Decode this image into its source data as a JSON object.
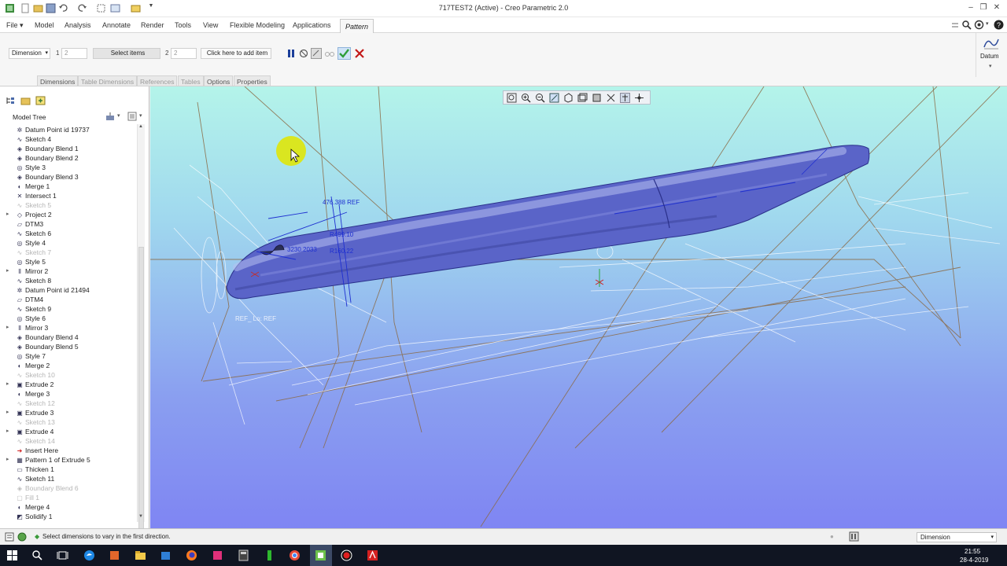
{
  "app": {
    "window_title": "717TEST2 (Active) - Creo Parametric 2.0"
  },
  "menu": {
    "file_label": "File",
    "items": [
      "Model",
      "Analysis",
      "Annotate",
      "Render",
      "Tools",
      "View",
      "Flexible Modeling",
      "Applications"
    ],
    "active_tab": "Pattern"
  },
  "ribbon": {
    "type_value": "Dimension",
    "dir1_index": "1",
    "dir1_count": "2",
    "dir1_select": "Select items",
    "dir2_index": "2",
    "dir2_count": "2",
    "dir2_add": "Click here to add item",
    "datum_label": "Datum",
    "subtabs": [
      "Dimensions",
      "Table Dimensions",
      "References",
      "Tables",
      "Options",
      "Properties"
    ]
  },
  "model_tree": {
    "header": "Model Tree",
    "items": [
      {
        "label": "Datum Point id 19737",
        "icon": "datum-point-icon",
        "icon_glyph": "✲",
        "state": "normal",
        "expandable": false
      },
      {
        "label": "Sketch 4",
        "icon": "sketch-icon",
        "icon_glyph": "∿",
        "state": "normal",
        "expandable": false
      },
      {
        "label": "Boundary Blend 1",
        "icon": "boundary-blend-icon",
        "icon_glyph": "◈",
        "state": "normal",
        "expandable": false
      },
      {
        "label": "Boundary Blend 2",
        "icon": "boundary-blend-icon",
        "icon_glyph": "◈",
        "state": "normal",
        "expandable": false
      },
      {
        "label": "Style 3",
        "icon": "style-icon",
        "icon_glyph": "◎",
        "state": "normal",
        "expandable": false
      },
      {
        "label": "Boundary Blend 3",
        "icon": "boundary-blend-icon",
        "icon_glyph": "◈",
        "state": "normal",
        "expandable": false
      },
      {
        "label": "Merge 1",
        "icon": "merge-icon",
        "icon_glyph": "◐",
        "state": "normal",
        "expandable": false
      },
      {
        "label": "Intersect 1",
        "icon": "intersect-icon",
        "icon_glyph": "✕",
        "state": "normal",
        "expandable": false
      },
      {
        "label": "Sketch 5",
        "icon": "sketch-icon",
        "icon_glyph": "∿",
        "state": "grey",
        "expandable": false
      },
      {
        "label": "Project 2",
        "icon": "project-icon",
        "icon_glyph": "◇",
        "state": "normal",
        "expandable": true
      },
      {
        "label": "DTM3",
        "icon": "datum-plane-icon",
        "icon_glyph": "▱",
        "state": "normal",
        "expandable": false
      },
      {
        "label": "Sketch 6",
        "icon": "sketch-icon",
        "icon_glyph": "∿",
        "state": "normal",
        "expandable": false
      },
      {
        "label": "Style 4",
        "icon": "style-icon",
        "icon_glyph": "◎",
        "state": "normal",
        "expandable": false
      },
      {
        "label": "Sketch 7",
        "icon": "sketch-icon",
        "icon_glyph": "∿",
        "state": "grey",
        "expandable": false
      },
      {
        "label": "Style 5",
        "icon": "style-icon",
        "icon_glyph": "◎",
        "state": "normal",
        "expandable": false
      },
      {
        "label": "Mirror 2",
        "icon": "mirror-icon",
        "icon_glyph": "⫴",
        "state": "normal",
        "expandable": true
      },
      {
        "label": "Sketch 8",
        "icon": "sketch-icon",
        "icon_glyph": "∿",
        "state": "normal",
        "expandable": false
      },
      {
        "label": "Datum Point id 21494",
        "icon": "datum-point-icon",
        "icon_glyph": "✲",
        "state": "normal",
        "expandable": false
      },
      {
        "label": "DTM4",
        "icon": "datum-plane-icon",
        "icon_glyph": "▱",
        "state": "normal",
        "expandable": false
      },
      {
        "label": "Sketch 9",
        "icon": "sketch-icon",
        "icon_glyph": "∿",
        "state": "normal",
        "expandable": false
      },
      {
        "label": "Style 6",
        "icon": "style-icon",
        "icon_glyph": "◎",
        "state": "normal",
        "expandable": false
      },
      {
        "label": "Mirror 3",
        "icon": "mirror-icon",
        "icon_glyph": "⫴",
        "state": "normal",
        "expandable": true
      },
      {
        "label": "Boundary Blend 4",
        "icon": "boundary-blend-icon",
        "icon_glyph": "◈",
        "state": "normal",
        "expandable": false
      },
      {
        "label": "Boundary Blend 5",
        "icon": "boundary-blend-icon",
        "icon_glyph": "◈",
        "state": "normal",
        "expandable": false
      },
      {
        "label": "Style 7",
        "icon": "style-icon",
        "icon_glyph": "◎",
        "state": "normal",
        "expandable": false
      },
      {
        "label": "Merge 2",
        "icon": "merge-icon",
        "icon_glyph": "◐",
        "state": "normal",
        "expandable": false
      },
      {
        "label": "Sketch 10",
        "icon": "sketch-icon",
        "icon_glyph": "∿",
        "state": "grey",
        "expandable": false
      },
      {
        "label": "Extrude 2",
        "icon": "extrude-icon",
        "icon_glyph": "▣",
        "state": "normal",
        "expandable": true
      },
      {
        "label": "Merge 3",
        "icon": "merge-icon",
        "icon_glyph": "◐",
        "state": "normal",
        "expandable": false
      },
      {
        "label": "Sketch 12",
        "icon": "sketch-icon",
        "icon_glyph": "∿",
        "state": "grey",
        "expandable": false
      },
      {
        "label": "Extrude 3",
        "icon": "extrude-icon",
        "icon_glyph": "▣",
        "state": "normal",
        "expandable": true
      },
      {
        "label": "Sketch 13",
        "icon": "sketch-icon",
        "icon_glyph": "∿",
        "state": "grey",
        "expandable": false
      },
      {
        "label": "Extrude 4",
        "icon": "extrude-icon",
        "icon_glyph": "▣",
        "state": "normal",
        "expandable": true
      },
      {
        "label": "Sketch 14",
        "icon": "sketch-icon",
        "icon_glyph": "∿",
        "state": "grey",
        "expandable": false
      },
      {
        "label": "Insert Here",
        "icon": "insert-here-icon",
        "icon_glyph": "➜",
        "state": "insert",
        "expandable": false
      },
      {
        "label": "Pattern 1 of Extrude 5",
        "icon": "pattern-icon",
        "icon_glyph": "▦",
        "state": "normal",
        "expandable": true
      },
      {
        "label": "Thicken 1",
        "icon": "thicken-icon",
        "icon_glyph": "▭",
        "state": "normal",
        "expandable": false
      },
      {
        "label": "Sketch 11",
        "icon": "sketch-icon",
        "icon_glyph": "∿",
        "state": "normal",
        "expandable": false
      },
      {
        "label": "Boundary Blend 6",
        "icon": "boundary-blend-icon",
        "icon_glyph": "◈",
        "state": "grey",
        "expandable": false
      },
      {
        "label": "Fill 1",
        "icon": "fill-icon",
        "icon_glyph": "▢",
        "state": "grey",
        "expandable": false
      },
      {
        "label": "Merge 4",
        "icon": "merge-icon",
        "icon_glyph": "◐",
        "state": "normal",
        "expandable": false
      },
      {
        "label": "Solidify 1",
        "icon": "solidify-icon",
        "icon_glyph": "◩",
        "state": "normal",
        "expandable": false
      }
    ]
  },
  "viewport": {
    "dimension_labels": [
      "476.388 REF",
      "3230.2033",
      "R499.10",
      "R160.22"
    ],
    "ref_label": "REF_ Lo: REF"
  },
  "status": {
    "message": "Select dimensions to vary in the first direction.",
    "filter_value": "Dimension"
  },
  "taskbar": {
    "time": "21:55",
    "date": "28-4-2019"
  },
  "colors": {
    "accent_check": "#2f9e3a",
    "cancel": "#c21818",
    "model_body": "#5a64c8",
    "sketch_line": "#1e2fd0"
  }
}
